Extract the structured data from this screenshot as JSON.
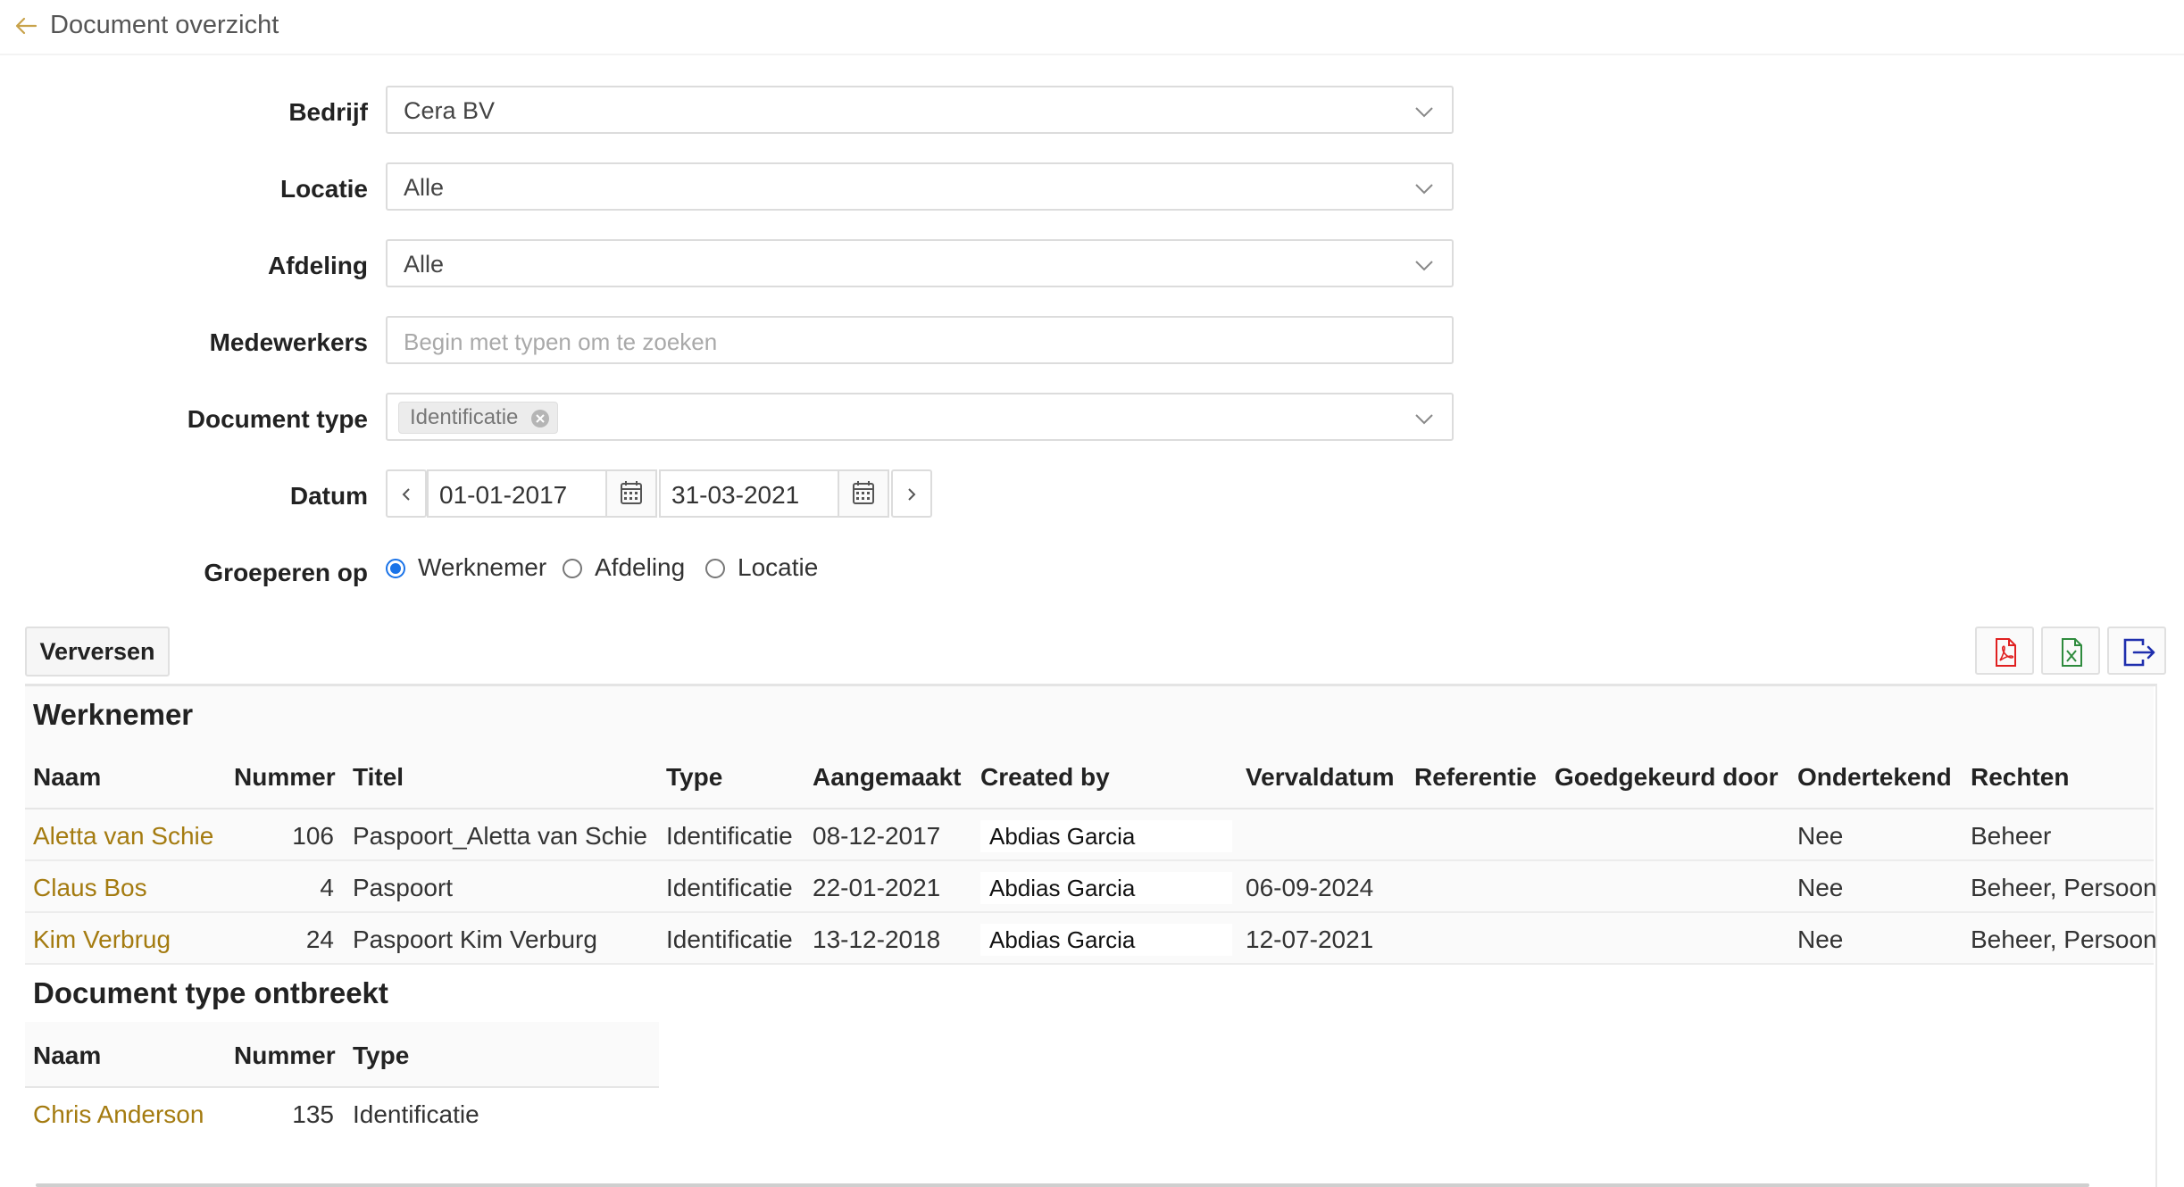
{
  "header": {
    "title": "Document overzicht"
  },
  "filters": {
    "bedrijf": {
      "label": "Bedrijf",
      "value": "Cera BV"
    },
    "locatie": {
      "label": "Locatie",
      "value": "Alle"
    },
    "afdeling": {
      "label": "Afdeling",
      "value": "Alle"
    },
    "medewerkers": {
      "label": "Medewerkers",
      "placeholder": "Begin met typen om te zoeken"
    },
    "document_type": {
      "label": "Document type",
      "tag": "Identificatie"
    },
    "datum": {
      "label": "Datum",
      "from": "01-01-2017",
      "to": "31-03-2021"
    },
    "groeperen": {
      "label": "Groeperen op",
      "options": [
        "Werknemer",
        "Afdeling",
        "Locatie"
      ],
      "selected": "Werknemer"
    }
  },
  "toolbar": {
    "refresh_label": "Verversen"
  },
  "colors": {
    "link": "#a47b10",
    "accent": "#1a73e8",
    "pdf": "#e02020",
    "excel": "#2e8b3d",
    "export": "#1f2fae"
  },
  "groups": [
    {
      "title": "Werknemer",
      "columns": [
        "Naam",
        "Nummer",
        "Titel",
        "Type",
        "Aangemaakt",
        "Created by",
        "Vervaldatum",
        "Referentie",
        "Goedgekeurd door",
        "Ondertekend",
        "Rechten"
      ],
      "rows": [
        {
          "naam": "Aletta van Schie",
          "nummer": "106",
          "titel": "Paspoort_Aletta van Schie",
          "type": "Identificatie",
          "aangemaakt": "08-12-2017",
          "created_by": "Abdias Garcia",
          "vervaldatum": "",
          "referentie": "",
          "goedgekeurd": "",
          "ondertekend": "Nee",
          "rechten": "Beheer"
        },
        {
          "naam": "Claus Bos",
          "nummer": "4",
          "titel": "Paspoort",
          "type": "Identificatie",
          "aangemaakt": "22-01-2021",
          "created_by": "Abdias Garcia",
          "vervaldatum": "06-09-2024",
          "referentie": "",
          "goedgekeurd": "",
          "ondertekend": "Nee",
          "rechten": "Beheer, Persoon"
        },
        {
          "naam": "Kim Verbrug",
          "nummer": "24",
          "titel": "Paspoort Kim Verburg",
          "type": "Identificatie",
          "aangemaakt": "13-12-2018",
          "created_by": "Abdias Garcia",
          "vervaldatum": "12-07-2021",
          "referentie": "",
          "goedgekeurd": "",
          "ondertekend": "Nee",
          "rechten": "Beheer, Persoon"
        }
      ]
    },
    {
      "title": "Document type ontbreekt",
      "columns": [
        "Naam",
        "Nummer",
        "Type"
      ],
      "rows": [
        {
          "naam": "Chris Anderson",
          "nummer": "135",
          "type": "Identificatie"
        }
      ]
    }
  ]
}
